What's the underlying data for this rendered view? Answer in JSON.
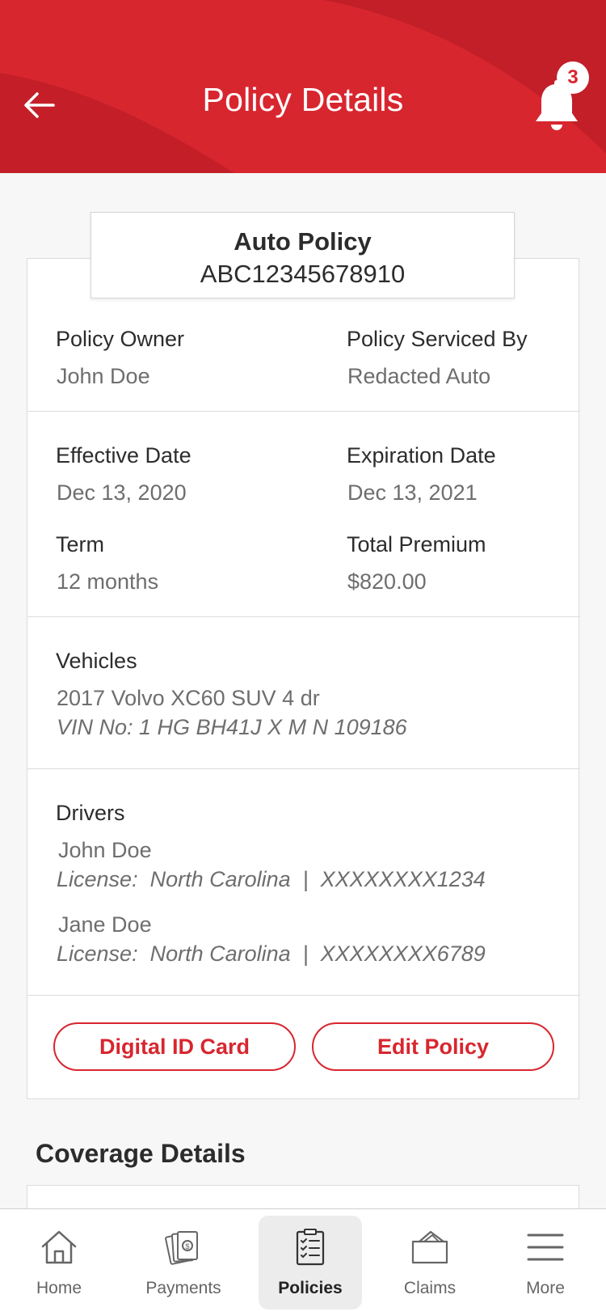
{
  "header": {
    "title": "Policy Details",
    "notification_count": "3"
  },
  "policy": {
    "type": "Auto Policy",
    "number": "ABC12345678910"
  },
  "owner": {
    "owner_label": "Policy Owner",
    "owner_value": "John Doe",
    "serviced_label": "Policy Serviced By",
    "serviced_value": "Redacted Auto"
  },
  "dates": {
    "effective_label": "Effective Date",
    "effective_value": "Dec 13, 2020",
    "expiration_label": "Expiration Date",
    "expiration_value": "Dec 13, 2021",
    "term_label": "Term",
    "term_value": "12 months",
    "premium_label": "Total Premium",
    "premium_value": "$820.00"
  },
  "vehicles": {
    "label": "Vehicles",
    "items": [
      {
        "name": "2017 Volvo XC60 SUV 4 dr",
        "vin": "VIN No:  1 HG BH41J X M N 109186"
      }
    ]
  },
  "drivers": {
    "label": "Drivers",
    "items": [
      {
        "name": "John Doe",
        "license": "License:  North Carolina  |  XXXXXXXX1234"
      },
      {
        "name": "Jane Doe",
        "license": "License:  North Carolina  |  XXXXXXXX6789"
      }
    ]
  },
  "actions": {
    "digital_id": "Digital ID Card",
    "edit_policy": "Edit Policy"
  },
  "coverage": {
    "heading": "Coverage Details"
  },
  "tabbar": {
    "active": "Policies",
    "items": [
      {
        "label": "Home",
        "icon": "home-icon"
      },
      {
        "label": "Payments",
        "icon": "payments-icon"
      },
      {
        "label": "Policies",
        "icon": "policies-icon"
      },
      {
        "label": "Claims",
        "icon": "claims-icon"
      },
      {
        "label": "More",
        "icon": "menu-icon"
      }
    ]
  },
  "colors": {
    "brand_red": "#d8262f",
    "header_dark": "#c01f28"
  }
}
